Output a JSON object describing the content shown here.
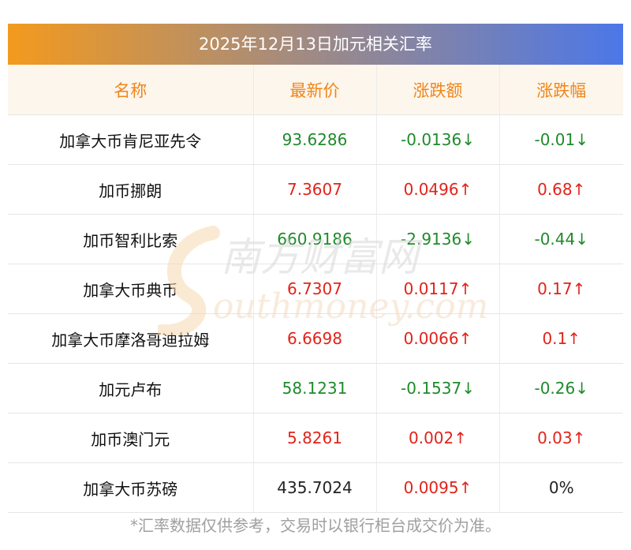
{
  "banner": {
    "title": "2025年12月13日加元相关汇率"
  },
  "table": {
    "headers": [
      "名称",
      "最新价",
      "涨跌额",
      "涨跌幅"
    ],
    "rows": [
      {
        "name": "加拿大币肯尼亚先令",
        "price": "93.6286",
        "change": "-0.0136↓",
        "pct": "-0.01↓",
        "dir": "down"
      },
      {
        "name": "加币挪朗",
        "price": "7.3607",
        "change": "0.0496↑",
        "pct": "0.68↑",
        "dir": "up"
      },
      {
        "name": "加币智利比索",
        "price": "660.9186",
        "change": "-2.9136↓",
        "pct": "-0.44↓",
        "dir": "down"
      },
      {
        "name": "加拿大币典币",
        "price": "6.7307",
        "change": "0.0117↑",
        "pct": "0.17↑",
        "dir": "up"
      },
      {
        "name": "加拿大币摩洛哥迪拉姆",
        "price": "6.6698",
        "change": "0.0066↑",
        "pct": "0.1↑",
        "dir": "up"
      },
      {
        "name": "加元卢布",
        "price": "58.1231",
        "change": "-0.1537↓",
        "pct": "-0.26↓",
        "dir": "down"
      },
      {
        "name": "加币澳门元",
        "price": "5.8261",
        "change": "0.002↑",
        "pct": "0.03↑",
        "dir": "up"
      },
      {
        "name": "加拿大币苏磅",
        "price": "435.7024",
        "change": "0.0095↑",
        "pct": "0%",
        "dir": "mixed"
      }
    ]
  },
  "footnote": "*汇率数据仅供参考，交易时以银行柜台成交价为准。",
  "watermark": {
    "cn": "南方财富网",
    "en": "outhmoney.com"
  },
  "colors": {
    "up": "#e2231a",
    "down": "#1f8a2b",
    "header_text": "#f08519",
    "header_bg": "#fdf6ec"
  }
}
